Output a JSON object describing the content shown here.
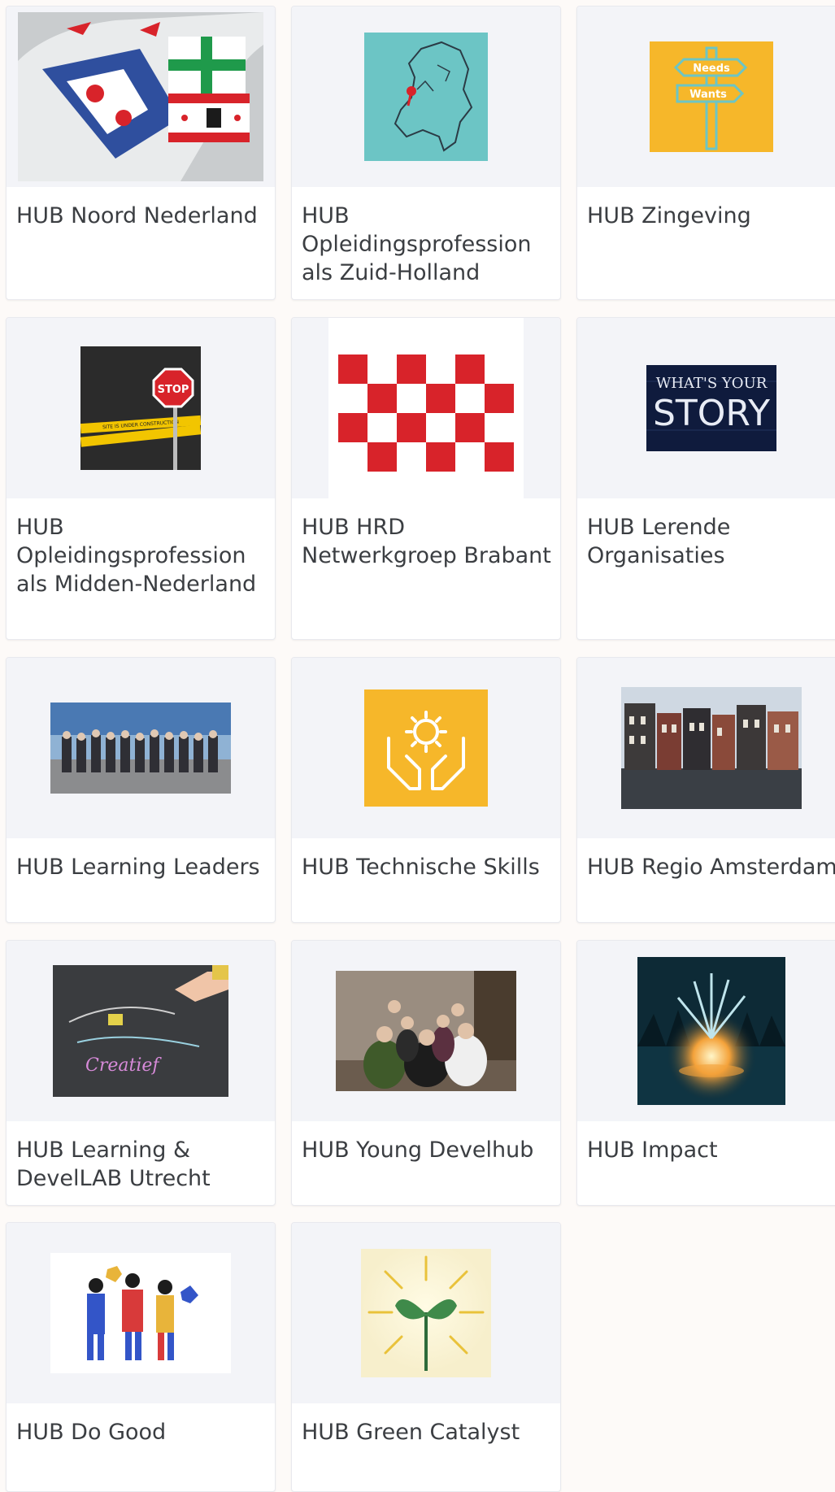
{
  "cards": [
    {
      "title": "HUB Noord Nederland"
    },
    {
      "title": "HUB Opleidingsprofession als Zuid-Holland",
      "map_icon": "netherlands-map-icon"
    },
    {
      "title": "HUB Zingeving",
      "sign_needs": "Needs",
      "sign_wants": "Wants"
    },
    {
      "title": "HUB Opleidingsprofession als Midden-Nederland",
      "stop_text": "STOP",
      "tape_text": "SITE IS UNDER CONSTRUCTION"
    },
    {
      "title": "HUB HRD Netwerkgroep Brabant"
    },
    {
      "title": "HUB Lerende Organisaties",
      "story_top": "WHAT'S YOUR",
      "story_main": "STORY"
    },
    {
      "title": "HUB Learning Leaders"
    },
    {
      "title": "HUB Technische Skills"
    },
    {
      "title": "HUB Regio Amsterdam"
    },
    {
      "title": "HUB Learning & DevelLAB Utrecht",
      "chalk_text": "Creatief"
    },
    {
      "title": "HUB Young Develhub"
    },
    {
      "title": "HUB Impact"
    },
    {
      "title": "HUB Do Good"
    },
    {
      "title": "HUB Green Catalyst"
    }
  ],
  "colors": {
    "page_bg": "#fdfaf8",
    "card_media_bg": "#f3f4f8",
    "title_text": "#3b3e42",
    "yellow": "#f6b72a",
    "teal": "#6cc5c5",
    "red": "#d8232a"
  }
}
